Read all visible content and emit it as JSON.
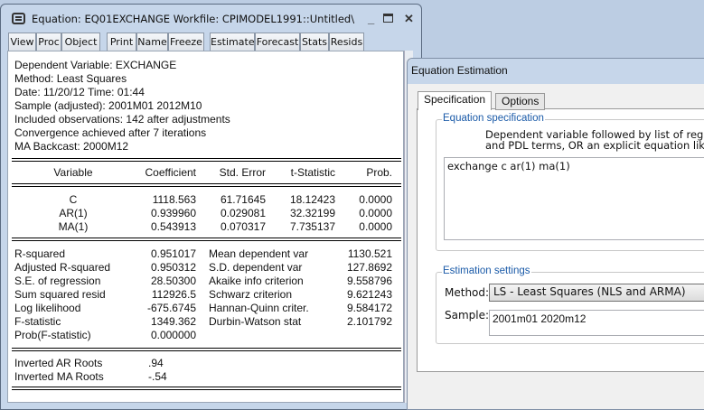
{
  "window": {
    "title": "Equation: EQ01EXCHANGE   Workfile: CPIMODEL1991::Untitled\\",
    "toolbar": [
      "View",
      "Proc",
      "Object",
      "Print",
      "Name",
      "Freeze",
      "Estimate",
      "Forecast",
      "Stats",
      "Resids"
    ]
  },
  "header": [
    "Dependent Variable: EXCHANGE",
    "Method: Least Squares",
    "Date: 11/20/12   Time: 01:44",
    "Sample (adjusted): 2001M01 2012M10",
    "Included observations: 142 after adjustments",
    "Convergence achieved after 7 iterations",
    "MA Backcast: 2000M12"
  ],
  "coef_table": {
    "columns": [
      "Variable",
      "Coefficient",
      "Std. Error",
      "t-Statistic",
      "Prob."
    ],
    "rows": [
      [
        "C",
        "1118.563",
        "61.71645",
        "18.12423",
        "0.0000"
      ],
      [
        "AR(1)",
        "0.939960",
        "0.029081",
        "32.32199",
        "0.0000"
      ],
      [
        "MA(1)",
        "0.543913",
        "0.070317",
        "7.735137",
        "0.0000"
      ]
    ]
  },
  "stats": [
    [
      "R-squared",
      "0.951017",
      "Mean dependent var",
      "1130.521"
    ],
    [
      "Adjusted R-squared",
      "0.950312",
      "S.D. dependent var",
      "127.8692"
    ],
    [
      "S.E. of regression",
      "28.50300",
      "Akaike info criterion",
      "9.558796"
    ],
    [
      "Sum squared resid",
      "112926.5",
      "Schwarz criterion",
      "9.621243"
    ],
    [
      "Log likelihood",
      "-675.6745",
      "Hannan-Quinn criter.",
      "9.584172"
    ],
    [
      "F-statistic",
      "1349.362",
      "Durbin-Watson stat",
      "2.101792"
    ],
    [
      "Prob(F-statistic)",
      "0.000000",
      "",
      ""
    ]
  ],
  "roots": [
    [
      "Inverted AR Roots",
      ".94"
    ],
    [
      "Inverted MA Roots",
      "-.54"
    ]
  ],
  "dialog": {
    "title": "Equation Estimation",
    "tabs": [
      "Specification",
      "Options"
    ],
    "spec_group": "Equation specification",
    "spec_desc1": "Dependent variable followed by list of regre",
    "spec_desc2": "and PDL terms, OR an explicit equation like",
    "spec_value": "exchange c ar(1) ma(1)",
    "settings_group": "Estimation settings",
    "method_label": "Method:",
    "method_value": "LS  -  Least Squares (NLS and ARMA)",
    "sample_label": "Sample:",
    "sample_value": "2001m01 2020m12"
  }
}
